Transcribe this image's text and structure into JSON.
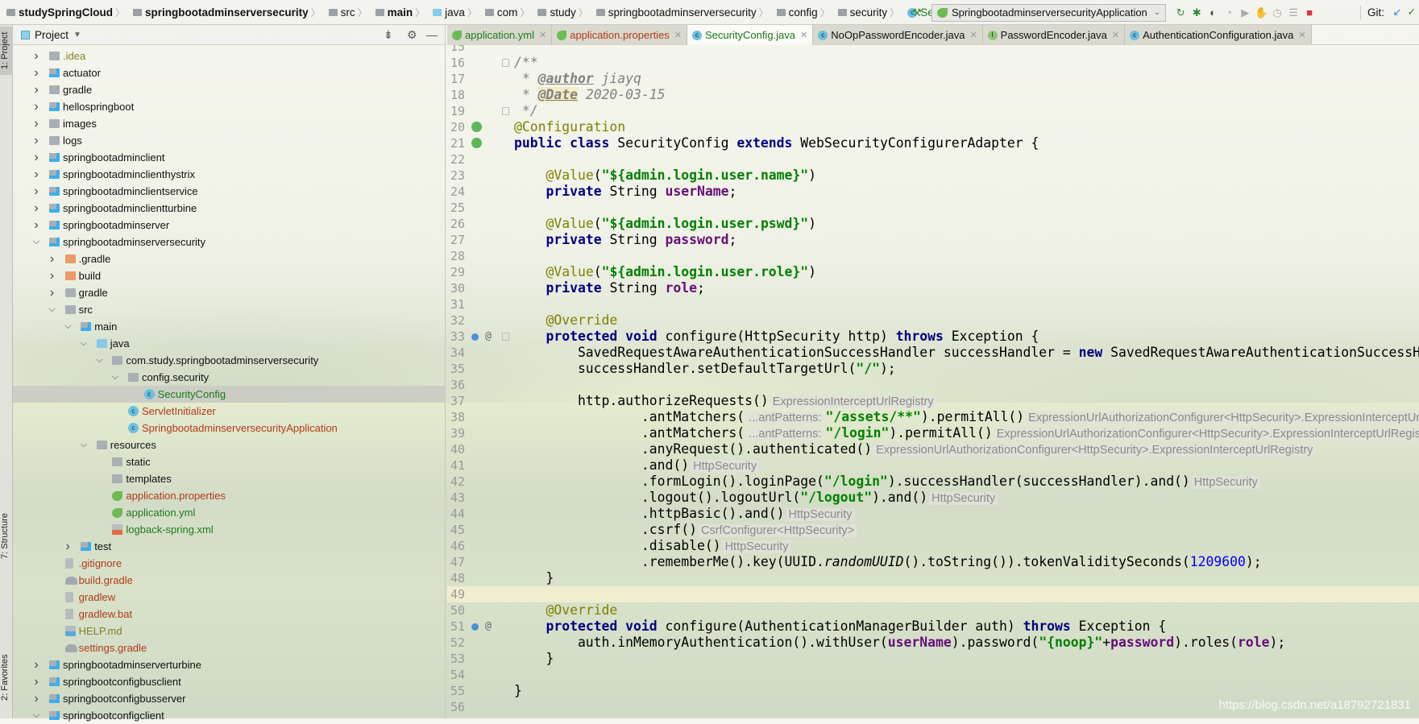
{
  "breadcrumb": [
    {
      "label": "studySpringCloud",
      "bold": true,
      "icon": "folder"
    },
    {
      "label": "springbootadminserversecurity",
      "bold": true,
      "icon": "folder"
    },
    {
      "label": "src",
      "icon": "folder"
    },
    {
      "label": "main",
      "bold": true,
      "icon": "folder"
    },
    {
      "label": "java",
      "icon": "java"
    },
    {
      "label": "com",
      "icon": "folder"
    },
    {
      "label": "study",
      "icon": "folder"
    },
    {
      "label": "springbootadminserversecurity",
      "icon": "folder"
    },
    {
      "label": "config",
      "icon": "folder"
    },
    {
      "label": "security",
      "icon": "folder"
    },
    {
      "label": "SecurityConfig",
      "icon": "class",
      "color": "#1d7a1d"
    }
  ],
  "toolbar": {
    "run_config": "SpringbootadminserversecurityApplication",
    "git_label": "Git:"
  },
  "left_strip": {
    "project": "1: Project",
    "structure": "7: Structure",
    "favorites": "2: Favorites"
  },
  "project_panel": {
    "title": "Project"
  },
  "tree": [
    {
      "level": 0,
      "chev": "right",
      "icon": "folder",
      "label": ".idea",
      "color": "#7f7f2a"
    },
    {
      "level": 0,
      "chev": "right",
      "icon": "module",
      "label": "actuator"
    },
    {
      "level": 0,
      "chev": "right",
      "icon": "folder",
      "label": "gradle"
    },
    {
      "level": 0,
      "chev": "right",
      "icon": "module",
      "label": "hellospringboot"
    },
    {
      "level": 0,
      "chev": "right",
      "icon": "folder",
      "label": "images"
    },
    {
      "level": 0,
      "chev": "right",
      "icon": "folder",
      "label": "logs"
    },
    {
      "level": 0,
      "chev": "right",
      "icon": "module",
      "label": "springbootadminclient"
    },
    {
      "level": 0,
      "chev": "right",
      "icon": "module",
      "label": "springbootadminclienthystrix"
    },
    {
      "level": 0,
      "chev": "right",
      "icon": "module",
      "label": "springbootadminclientservice"
    },
    {
      "level": 0,
      "chev": "right",
      "icon": "module",
      "label": "springbootadminclientturbine"
    },
    {
      "level": 0,
      "chev": "right",
      "icon": "module",
      "label": "springbootadminserver"
    },
    {
      "level": 0,
      "chev": "down",
      "icon": "module",
      "label": "springbootadminserversecurity"
    },
    {
      "level": 1,
      "chev": "right",
      "icon": "orange",
      "label": ".gradle"
    },
    {
      "level": 1,
      "chev": "right",
      "icon": "orange",
      "label": "build"
    },
    {
      "level": 1,
      "chev": "right",
      "icon": "folder",
      "label": "gradle"
    },
    {
      "level": 1,
      "chev": "down",
      "icon": "folder",
      "label": "src"
    },
    {
      "level": 2,
      "chev": "down",
      "icon": "module",
      "label": "main"
    },
    {
      "level": 3,
      "chev": "down",
      "icon": "java",
      "label": "java"
    },
    {
      "level": 4,
      "chev": "down",
      "icon": "pkg",
      "label": "com.study.springbootadminserversecurity"
    },
    {
      "level": 5,
      "chev": "down",
      "icon": "pkg",
      "label": "config.security"
    },
    {
      "level": 6,
      "chev": "",
      "icon": "cls",
      "label": "SecurityConfig",
      "color": "#1d7a1d",
      "selected": true
    },
    {
      "level": 5,
      "chev": "",
      "icon": "cls",
      "label": "ServletInitializer",
      "color": "#b13a1a"
    },
    {
      "level": 5,
      "chev": "",
      "icon": "cls",
      "label": "SpringbootadminserversecurityApplication",
      "color": "#b13a1a"
    },
    {
      "level": 3,
      "chev": "down",
      "icon": "folder",
      "label": "resources"
    },
    {
      "level": 4,
      "chev": "",
      "icon": "pkg",
      "label": "static"
    },
    {
      "level": 4,
      "chev": "",
      "icon": "pkg",
      "label": "templates"
    },
    {
      "level": 4,
      "chev": "",
      "icon": "spring",
      "label": "application.properties",
      "color": "#b13a1a"
    },
    {
      "level": 4,
      "chev": "",
      "icon": "spring",
      "label": "application.yml",
      "color": "#1d7a1d"
    },
    {
      "level": 4,
      "chev": "",
      "icon": "xml",
      "label": "logback-spring.xml",
      "color": "#1d7a1d"
    },
    {
      "level": 2,
      "chev": "right",
      "icon": "module",
      "label": "test"
    },
    {
      "level": 1,
      "chev": "",
      "icon": "file",
      "label": ".gitignore",
      "color": "#b13a1a"
    },
    {
      "level": 1,
      "chev": "",
      "icon": "gradle",
      "label": "build.gradle",
      "color": "#b13a1a"
    },
    {
      "level": 1,
      "chev": "",
      "icon": "file",
      "label": "gradlew",
      "color": "#b13a1a"
    },
    {
      "level": 1,
      "chev": "",
      "icon": "file",
      "label": "gradlew.bat",
      "color": "#b13a1a"
    },
    {
      "level": 1,
      "chev": "",
      "icon": "md",
      "label": "HELP.md",
      "color": "#7f7f2a"
    },
    {
      "level": 1,
      "chev": "",
      "icon": "gradle",
      "label": "settings.gradle",
      "color": "#b13a1a"
    },
    {
      "level": 0,
      "chev": "right",
      "icon": "module",
      "label": "springbootadminserverturbine"
    },
    {
      "level": 0,
      "chev": "right",
      "icon": "module",
      "label": "springbootconfigbusclient"
    },
    {
      "level": 0,
      "chev": "right",
      "icon": "module",
      "label": "springbootconfigbusserver"
    },
    {
      "level": 0,
      "chev": "down",
      "icon": "module",
      "label": "springbootconfigclient"
    }
  ],
  "tabs": [
    {
      "label": "application.yml",
      "color": "#1d7a1d",
      "icon": "spring"
    },
    {
      "label": "application.properties",
      "color": "#b13a1a",
      "icon": "spring"
    },
    {
      "label": "SecurityConfig.java",
      "color": "#1d7a1d",
      "icon": "class",
      "active": true
    },
    {
      "label": "NoOpPasswordEncoder.java",
      "icon": "class"
    },
    {
      "label": "PasswordEncoder.java",
      "icon": "interface"
    },
    {
      "label": "AuthenticationConfiguration.java",
      "icon": "class"
    }
  ],
  "code": [
    {
      "n": 15,
      "t": []
    },
    {
      "n": 16,
      "fold": true,
      "t": [
        [
          "cm",
          "/**"
        ]
      ]
    },
    {
      "n": 17,
      "t": [
        [
          "cm",
          " * "
        ],
        [
          "tag",
          "@author"
        ],
        [
          "cm",
          " jiayq"
        ]
      ]
    },
    {
      "n": 18,
      "t": [
        [
          "cm",
          " * "
        ],
        [
          "tag hl",
          "@Date"
        ],
        [
          "cm",
          " 2020-03-15"
        ]
      ]
    },
    {
      "n": 19,
      "fold": true,
      "t": [
        [
          "cm",
          " */"
        ]
      ]
    },
    {
      "n": 20,
      "gutter": "spring-bean",
      "t": [
        [
          "ann",
          "@Configuration"
        ]
      ]
    },
    {
      "n": 21,
      "gutter": "spring-class",
      "t": [
        [
          "kw",
          "public class "
        ],
        [
          "",
          "SecurityConfig "
        ],
        [
          "kw",
          "extends "
        ],
        [
          "",
          "WebSecurityConfigurerAdapter {"
        ]
      ]
    },
    {
      "n": 22,
      "t": []
    },
    {
      "n": 23,
      "t": [
        [
          "",
          "    "
        ],
        [
          "ann",
          "@Value"
        ],
        [
          "",
          "("
        ],
        [
          "str",
          "\"${admin.login.user.name}\""
        ],
        [
          "",
          ")"
        ]
      ]
    },
    {
      "n": 24,
      "t": [
        [
          "",
          "    "
        ],
        [
          "kw",
          "private "
        ],
        [
          "",
          "String "
        ],
        [
          "fld",
          "userName"
        ],
        [
          "",
          ";"
        ]
      ]
    },
    {
      "n": 25,
      "t": []
    },
    {
      "n": 26,
      "t": [
        [
          "",
          "    "
        ],
        [
          "ann",
          "@Value"
        ],
        [
          "",
          "("
        ],
        [
          "str",
          "\"${admin.login.user.pswd}\""
        ],
        [
          "",
          ")"
        ]
      ]
    },
    {
      "n": 27,
      "t": [
        [
          "",
          "    "
        ],
        [
          "kw",
          "private "
        ],
        [
          "",
          "String "
        ],
        [
          "fld",
          "password"
        ],
        [
          "",
          ";"
        ]
      ]
    },
    {
      "n": 28,
      "t": []
    },
    {
      "n": 29,
      "t": [
        [
          "",
          "    "
        ],
        [
          "ann",
          "@Value"
        ],
        [
          "",
          "("
        ],
        [
          "str",
          "\"${admin.login.user.role}\""
        ],
        [
          "",
          ")"
        ]
      ]
    },
    {
      "n": 30,
      "t": [
        [
          "",
          "    "
        ],
        [
          "kw",
          "private "
        ],
        [
          "",
          "String "
        ],
        [
          "fld",
          "role"
        ],
        [
          "",
          ";"
        ]
      ]
    },
    {
      "n": 31,
      "t": []
    },
    {
      "n": 32,
      "t": [
        [
          "",
          "    "
        ],
        [
          "ann",
          "@Override"
        ]
      ]
    },
    {
      "n": 33,
      "gutter": "override",
      "fold": true,
      "t": [
        [
          "",
          "    "
        ],
        [
          "kw",
          "protected void "
        ],
        [
          "",
          "configure(HttpSecurity http) "
        ],
        [
          "kw",
          "throws "
        ],
        [
          "",
          "Exception {"
        ]
      ]
    },
    {
      "n": 34,
      "t": [
        [
          "",
          "        SavedRequestAwareAuthenticationSuccessHandler successHandler = "
        ],
        [
          "kw",
          "new "
        ],
        [
          "",
          "SavedRequestAwareAuthenticationSuccessHandler();"
        ]
      ]
    },
    {
      "n": 35,
      "t": [
        [
          "",
          "        successHandler.setDefaultTargetUrl("
        ],
        [
          "str",
          "\"/\""
        ],
        [
          "",
          ");"
        ]
      ]
    },
    {
      "n": 36,
      "t": []
    },
    {
      "n": 37,
      "t": [
        [
          "",
          "        http.authorizeRequests()"
        ],
        [
          "hint",
          "ExpressionInterceptUrlRegistry"
        ]
      ]
    },
    {
      "n": 38,
      "t": [
        [
          "",
          "                .antMatchers("
        ],
        [
          "hint",
          "...antPatterns:"
        ],
        [
          "str",
          "\"/assets/**\""
        ],
        [
          "",
          ").permitAll()"
        ],
        [
          "hint",
          "ExpressionUrlAuthorizationConfigurer<HttpSecurity>.ExpressionInterceptUrlRegistry"
        ]
      ]
    },
    {
      "n": 39,
      "t": [
        [
          "",
          "                .antMatchers("
        ],
        [
          "hint",
          "...antPatterns:"
        ],
        [
          "str",
          "\"/login\""
        ],
        [
          "",
          ").permitAll()"
        ],
        [
          "hint",
          "ExpressionUrlAuthorizationConfigurer<HttpSecurity>.ExpressionInterceptUrlRegistry"
        ]
      ]
    },
    {
      "n": 40,
      "t": [
        [
          "",
          "                .anyRequest().authenticated()"
        ],
        [
          "hint",
          "ExpressionUrlAuthorizationConfigurer<HttpSecurity>.ExpressionInterceptUrlRegistry"
        ]
      ]
    },
    {
      "n": 41,
      "t": [
        [
          "",
          "                .and()"
        ],
        [
          "hint",
          "HttpSecurity"
        ]
      ]
    },
    {
      "n": 42,
      "t": [
        [
          "",
          "                .formLogin().loginPage("
        ],
        [
          "str",
          "\"/login\""
        ],
        [
          "",
          ").successHandler(successHandler).and()"
        ],
        [
          "hint",
          "HttpSecurity"
        ]
      ]
    },
    {
      "n": 43,
      "t": [
        [
          "",
          "                .logout().logoutUrl("
        ],
        [
          "str",
          "\"/logout\""
        ],
        [
          "",
          ").and()"
        ],
        [
          "hint",
          "HttpSecurity"
        ]
      ]
    },
    {
      "n": 44,
      "t": [
        [
          "",
          "                .httpBasic().and()"
        ],
        [
          "hint",
          "HttpSecurity"
        ]
      ]
    },
    {
      "n": 45,
      "t": [
        [
          "",
          "                .csrf()"
        ],
        [
          "hint",
          "CsrfConfigurer<HttpSecurity>"
        ]
      ]
    },
    {
      "n": 46,
      "t": [
        [
          "",
          "                .disable()"
        ],
        [
          "hint",
          "HttpSecurity"
        ]
      ]
    },
    {
      "n": 47,
      "t": [
        [
          "",
          "                .rememberMe().key(UUID."
        ],
        [
          "it",
          "randomUUID"
        ],
        [
          "",
          "().toString()).tokenValiditySeconds("
        ],
        [
          "num",
          "1209600"
        ],
        [
          "",
          ");"
        ]
      ]
    },
    {
      "n": 48,
      "t": [
        [
          "",
          "    }"
        ]
      ]
    },
    {
      "n": 49,
      "current": true,
      "t": []
    },
    {
      "n": 50,
      "t": [
        [
          "",
          "    "
        ],
        [
          "ann",
          "@Override"
        ]
      ]
    },
    {
      "n": 51,
      "gutter": "override",
      "t": [
        [
          "",
          "    "
        ],
        [
          "kw",
          "protected void "
        ],
        [
          "",
          "configure(AuthenticationManagerBuilder auth) "
        ],
        [
          "kw",
          "throws "
        ],
        [
          "",
          "Exception {"
        ]
      ]
    },
    {
      "n": 52,
      "t": [
        [
          "",
          "        auth.inMemoryAuthentication().withUser("
        ],
        [
          "fld",
          "userName"
        ],
        [
          "",
          ").password("
        ],
        [
          "str",
          "\"{noop}\""
        ],
        [
          "",
          "+"
        ],
        [
          "fld",
          "password"
        ],
        [
          "",
          ").roles("
        ],
        [
          "fld",
          "role"
        ],
        [
          "",
          ");"
        ]
      ]
    },
    {
      "n": 53,
      "t": [
        [
          "",
          "    }"
        ]
      ]
    },
    {
      "n": 54,
      "t": []
    },
    {
      "n": 55,
      "t": [
        [
          "",
          "}"
        ]
      ]
    },
    {
      "n": 56,
      "t": []
    }
  ],
  "watermark": "https://blog.csdn.net/a18792721831"
}
